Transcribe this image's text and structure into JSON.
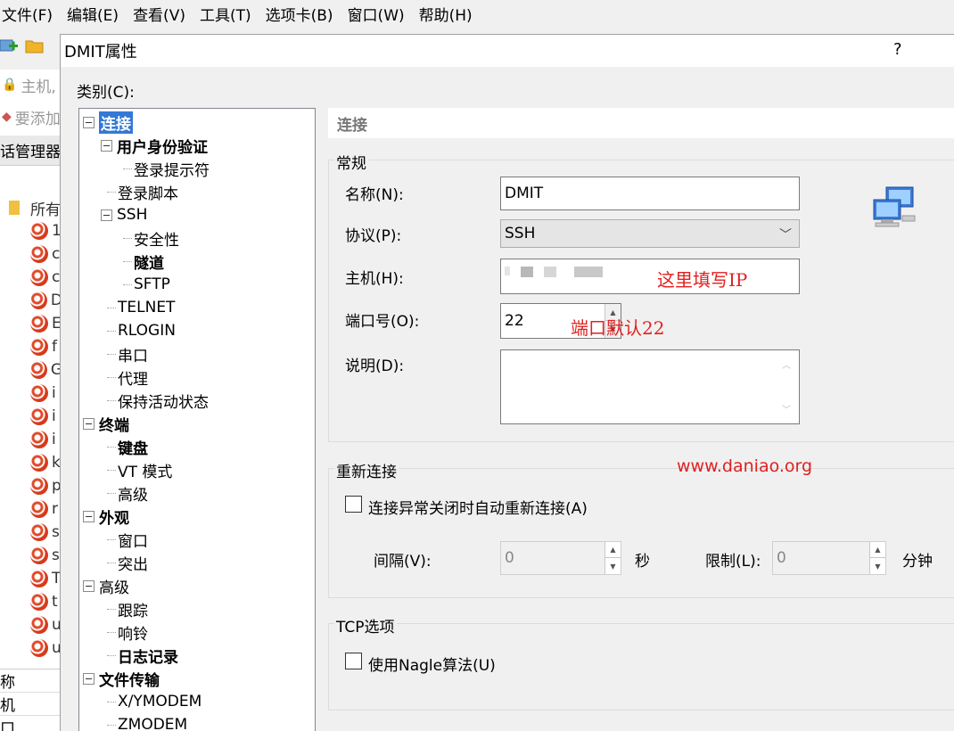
{
  "app": {
    "menu": [
      "文件(F)",
      "编辑(E)",
      "查看(V)",
      "工具(T)",
      "选项卡(B)",
      "窗口(W)",
      "帮助(H)"
    ],
    "toolbar_hint": [
      "主机,",
      "要添加"
    ],
    "session_panel_title": "话管理器",
    "tree_root_label": "所有",
    "session_letters": [
      "1",
      "c",
      "c",
      "D",
      "E",
      "f",
      "G",
      "i",
      "i",
      "i",
      "k",
      "p",
      "r",
      "s",
      "s",
      "T",
      "t",
      "u",
      "u"
    ],
    "props_rows": [
      "称",
      "机",
      "口"
    ]
  },
  "dialog": {
    "title": "DMIT属性",
    "help": "?",
    "category_label": "类别(C):",
    "tree": [
      {
        "label": "连接",
        "level": 0,
        "bold": true,
        "selected": true,
        "expander": true
      },
      {
        "label": "用户身份验证",
        "level": 1,
        "bold": true,
        "expander": true
      },
      {
        "label": "登录提示符",
        "level": 2
      },
      {
        "label": "登录脚本",
        "level": 1
      },
      {
        "label": "SSH",
        "level": 1,
        "expander": true
      },
      {
        "label": "安全性",
        "level": 2
      },
      {
        "label": "隧道",
        "level": 2,
        "bold": true
      },
      {
        "label": "SFTP",
        "level": 2
      },
      {
        "label": "TELNET",
        "level": 1
      },
      {
        "label": "RLOGIN",
        "level": 1
      },
      {
        "label": "串口",
        "level": 1
      },
      {
        "label": "代理",
        "level": 1
      },
      {
        "label": "保持活动状态",
        "level": 1
      },
      {
        "label": "终端",
        "level": 0,
        "bold": true,
        "expander": true
      },
      {
        "label": "键盘",
        "level": 1,
        "bold": true
      },
      {
        "label": "VT 模式",
        "level": 1
      },
      {
        "label": "高级",
        "level": 1
      },
      {
        "label": "外观",
        "level": 0,
        "bold": true,
        "expander": true
      },
      {
        "label": "窗口",
        "level": 1
      },
      {
        "label": "突出",
        "level": 1
      },
      {
        "label": "高级",
        "level": 0,
        "expander": true
      },
      {
        "label": "跟踪",
        "level": 1
      },
      {
        "label": "响铃",
        "level": 1
      },
      {
        "label": "日志记录",
        "level": 1,
        "bold": true
      },
      {
        "label": "文件传输",
        "level": 0,
        "bold": true,
        "expander": true
      },
      {
        "label": "X/YMODEM",
        "level": 1
      },
      {
        "label": "ZMODEM",
        "level": 1
      }
    ],
    "section_title": "连接",
    "general": {
      "legend": "常规",
      "name_label": "名称(N):",
      "name_value": "DMIT",
      "protocol_label": "协议(P):",
      "protocol_value": "SSH",
      "host_label": "主机(H):",
      "host_annotation": "这里填写IP",
      "port_label": "端口号(O):",
      "port_value": "22",
      "port_annotation": "端口默认22",
      "desc_label": "说明(D):",
      "desc_value": ""
    },
    "reconnect": {
      "legend": "重新连接",
      "auto_reconnect_label": "连接异常关闭时自动重新连接(A)",
      "auto_reconnect_checked": false,
      "interval_label": "间隔(V):",
      "interval_value": "0",
      "interval_unit": "秒",
      "limit_label": "限制(L):",
      "limit_value": "0",
      "limit_unit": "分钟"
    },
    "watermark": "www.daniao.org",
    "tcp": {
      "legend": "TCP选项",
      "nagle_label": "使用Nagle算法(U)",
      "nagle_checked": false
    }
  },
  "colors": {
    "selection": "#3478d5",
    "annotation": "#e02020"
  }
}
